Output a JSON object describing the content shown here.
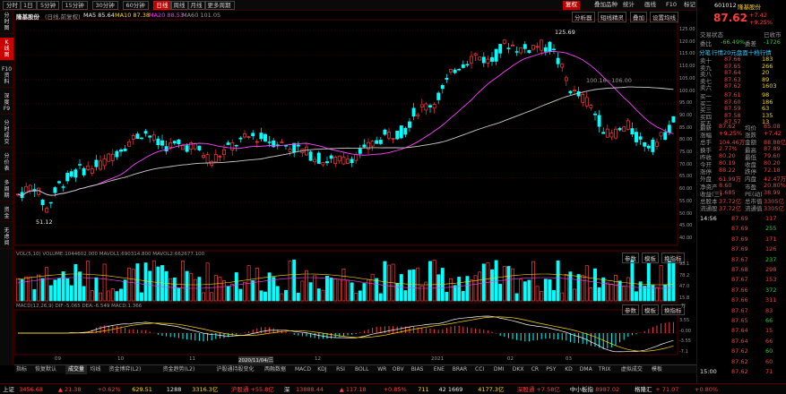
{
  "colors": {
    "up": "#ff3b3b",
    "down": "#00ffff",
    "ma5": "#ffffff",
    "ma10": "#ffd800",
    "ma20": "#ff40ff",
    "ma60": "#cccccc",
    "bg": "#000000",
    "accent": "#cc0000"
  },
  "topbar": {
    "periods": [
      "分时",
      "1日",
      "5分钟",
      "15分钟",
      "30分钟",
      "60分钟",
      "日线",
      "周线",
      "月线",
      "更多周期"
    ],
    "active_period": "日线",
    "ctrls": [
      "复权",
      "叠加品种",
      "统计",
      "画线",
      "F10",
      "标记",
      "+自选",
      "返回"
    ]
  },
  "left_tabs": [
    {
      "label": "分\n时\n图",
      "active": false
    },
    {
      "label": "K\n线\n图",
      "active": true
    },
    {
      "label": "F10\n资\n料",
      "active": false
    },
    {
      "label": "深\n度\nF9",
      "active": false
    },
    {
      "label": "分\n时\n成\n交",
      "active": false
    },
    {
      "label": "分\n价\n表",
      "active": false
    },
    {
      "label": "多\n周\n期",
      "active": false
    },
    {
      "label": "资\n金",
      "active": false
    },
    {
      "label": "无\n虑\n阅",
      "active": false
    }
  ],
  "main": {
    "title": "隆基股份",
    "sub": "(日线,前复权)",
    "ma_legend": {
      "ma5": "MA5 85.64",
      "ma10": "MA10 87.38",
      "ma20": "MA20 88.53",
      "ma60": "MA60 101.05"
    },
    "right_ctrls": [
      "分析器",
      "短线精灵",
      "叠加",
      "设置均线"
    ],
    "hi_label": "125.69",
    "lo_label": "51.12",
    "range_label": "100.16~106.00"
  },
  "vol": {
    "legend": "VOL(5,10)  VOLUME:1044602.000  MAVOL1:690314.800  MAVOL2:662677.100",
    "ctrls": [
      "参数",
      "模板",
      "换指标"
    ]
  },
  "macd": {
    "legend": "MACD(12,26,9)  DIF:-5.065  DEA:-6.549  MACD:1.366",
    "ctrls": [
      "参数",
      "模板",
      "换指标"
    ]
  },
  "axes": {
    "price": [
      "125.00",
      "120.00",
      "115.00",
      "110.00",
      "105.00",
      "100.00",
      "95.00",
      "90.00",
      "85.00",
      "80.00",
      "75.00",
      "70.00",
      "65.00",
      "60.00",
      "55.00",
      "50.00",
      "45.00",
      "40.00"
    ],
    "vol": [
      "93.1",
      "78.2",
      "47.0",
      "15.8"
    ],
    "macd": [
      "3.55",
      "-0.00",
      "-3.55",
      "-7.1"
    ],
    "vol_unit": "万",
    "dates": [
      "09",
      "10",
      "11",
      "2020/11/04/三",
      "12",
      "2021",
      "02",
      "03"
    ]
  },
  "bottom_tabs": [
    "指标",
    "恢复默认",
    "成交量",
    "均线",
    "资金博弈(L2)",
    "资金趋势(L2)",
    "沪股通持股变化",
    "两融数据",
    "MACD",
    "KDJ",
    "RSI",
    "BOLL",
    "WR",
    "OBV",
    "BIAS",
    "ENE",
    "BRAR",
    "CCI",
    "DMI",
    "DKX",
    "CR",
    "PSY",
    "KD",
    "DMA",
    "TRIX",
    "虚拟成交",
    "模板"
  ],
  "quote": {
    "code": "601012",
    "name": "隆基股份",
    "price": "87.62",
    "chg": "+7.42",
    "pct": "+9.25%",
    "status_l": "交易状态",
    "status_r": "已收市",
    "weibi": "委比",
    "weibi_v": "-66.49%",
    "weicha": "委差",
    "weicha_v": "-1726",
    "order_tag": "分笔",
    "rank_label": "行情20元盘面十档行情",
    "asks": [
      [
        "卖十",
        "87.66",
        "183"
      ],
      [
        "卖九",
        "87.65",
        "266"
      ],
      [
        "卖八",
        "87.64",
        "20"
      ],
      [
        "卖七",
        "87.63",
        "89"
      ],
      [
        "卖六",
        "87.62",
        "1603"
      ]
    ],
    "bids": [
      [
        "买一",
        "87.61",
        "98"
      ],
      [
        "买二",
        "87.60",
        "186"
      ],
      [
        "买三",
        "87.59",
        "63"
      ],
      [
        "买四",
        "87.58",
        "135"
      ],
      [
        "买五",
        "87.57",
        "13"
      ]
    ],
    "stats": [
      [
        "最新",
        "87.62",
        "均价",
        "85.08"
      ],
      [
        "涨幅",
        "+9.25%",
        "涨跌",
        "+7.42"
      ],
      [
        "总手",
        "104.46万",
        "金额",
        "88.88亿"
      ],
      [
        "换手",
        "2.77%",
        "最高",
        "87.89"
      ],
      [
        "昨收",
        "80.20",
        "最低",
        "79.60"
      ],
      [
        "今开",
        "80.19",
        "收盘",
        "80.20"
      ],
      [
        "涨停",
        "88.22",
        "跌停",
        "72.18"
      ],
      [
        "外盘",
        "61.99万",
        "内盘",
        "42.47万"
      ],
      [
        "净资产",
        "8.60",
        "市盈",
        "20.80%"
      ],
      [
        "收益(三)",
        "1.685",
        "PE(动)",
        "38.99"
      ],
      [
        "总股本",
        "37.72亿",
        "总市值",
        "3305亿"
      ],
      [
        "流通股",
        "37.72亿",
        "流通值",
        "3305亿"
      ]
    ],
    "ticks": [
      [
        "14:56",
        "87.69",
        "117"
      ],
      [
        "",
        "87.69",
        "255"
      ],
      [
        "",
        "87.69",
        "171"
      ],
      [
        "",
        "87.69",
        "126"
      ],
      [
        "",
        "87.67",
        "237"
      ],
      [
        "",
        "87.68",
        "298"
      ],
      [
        "",
        "87.67",
        "153"
      ],
      [
        "",
        "87.66",
        "372"
      ],
      [
        "",
        "87.66",
        "311"
      ],
      [
        "",
        "87.67",
        "83"
      ],
      [
        "",
        "87.65",
        "66"
      ],
      [
        "",
        "87.64",
        "15"
      ],
      [
        "",
        "87.64",
        "66"
      ],
      [
        "",
        "87.62",
        "60"
      ],
      [
        "",
        "87.62",
        "60"
      ],
      [
        "15:00",
        "87.62",
        "71"
      ]
    ]
  },
  "statusbar": [
    {
      "t": "上证",
      "c": "wht"
    },
    {
      "t": "3456.68",
      "c": "red"
    },
    {
      "t": "▲ 21.38",
      "c": "red"
    },
    {
      "t": "+0.62%",
      "c": "red"
    },
    {
      "t": "629.51",
      "c": "yel"
    },
    {
      "t": "1288",
      "c": "wht"
    },
    {
      "t": "3316.3亿",
      "c": "yel"
    },
    {
      "t": "沪股通 +55.8亿",
      "c": "red"
    },
    {
      "t": "深",
      "c": "wht"
    },
    {
      "t": "13888.44",
      "c": "red"
    },
    {
      "t": "▲ 117.18",
      "c": "red"
    },
    {
      "t": "+0.85%",
      "c": "red"
    },
    {
      "t": "711",
      "c": "yel"
    },
    {
      "t": "42 1669",
      "c": "wht"
    },
    {
      "t": "4177.3亿",
      "c": "yel"
    },
    {
      "t": "深股通 +7.58亿",
      "c": "red"
    },
    {
      "t": "中小板指",
      "c": "wht"
    },
    {
      "t": "8987.02",
      "c": "red"
    },
    {
      "t": "格隆汇",
      "c": "wht"
    },
    {
      "t": "+ 71.07",
      "c": "red"
    },
    {
      "t": "+0.80%",
      "c": "red"
    }
  ]
}
